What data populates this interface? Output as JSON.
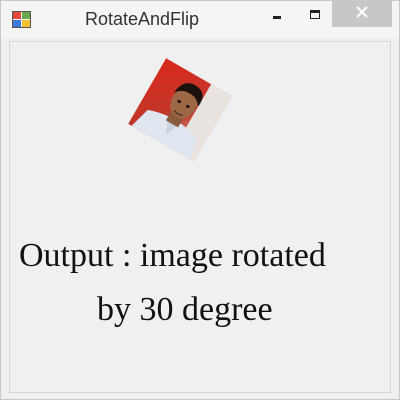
{
  "window": {
    "title": "RotateAndFlip",
    "app_icon": "windows-form-icon",
    "controls": {
      "minimize_icon": "minimize-icon",
      "maximize_icon": "maximize-icon",
      "close_icon": "close-icon"
    }
  },
  "content": {
    "image": {
      "description_icon": "rotated-photo",
      "rotation_degrees": 30
    },
    "caption_line1": "Output : image rotated",
    "caption_line2": "by 30 degree"
  },
  "colors": {
    "titlebar": "#f5f5f5",
    "close_button": "#c7c7c7",
    "client_background": "#f0f0f0"
  }
}
